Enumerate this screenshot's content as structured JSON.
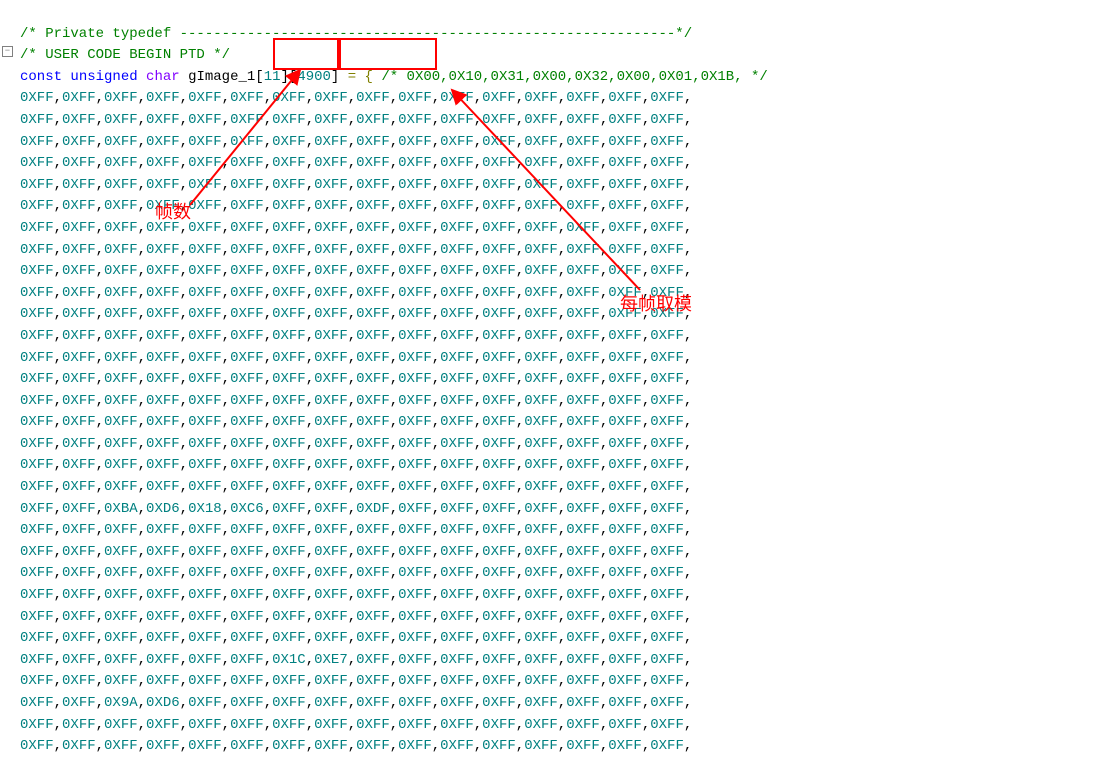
{
  "code": {
    "comment_line1": "/* Private typedef -----------------------------------------------------------*/",
    "comment_line2": "/* USER CODE BEGIN PTD */",
    "decl": {
      "const": "const",
      "unsigned": "unsigned",
      "char": "char",
      "name": "gImage_1",
      "dim1_open": "[",
      "dim1_val": "11",
      "dim1_close": "]",
      "dim2_open": "[",
      "dim2_val": "4900",
      "dim2_close": "]",
      "assign": " = {",
      "trailing_comment": " /* 0X00,0X10,0X31,0X00,0X32,0X00,0X01,0X1B, */"
    },
    "rows": [
      [
        "0XFF",
        "0XFF",
        "0XFF",
        "0XFF",
        "0XFF",
        "0XFF",
        "0XFF",
        "0XFF",
        "0XFF",
        "0XFF",
        "0XFF",
        "0XFF",
        "0XFF",
        "0XFF",
        "0XFF",
        "0XFF"
      ],
      [
        "0XFF",
        "0XFF",
        "0XFF",
        "0XFF",
        "0XFF",
        "0XFF",
        "0XFF",
        "0XFF",
        "0XFF",
        "0XFF",
        "0XFF",
        "0XFF",
        "0XFF",
        "0XFF",
        "0XFF",
        "0XFF"
      ],
      [
        "0XFF",
        "0XFF",
        "0XFF",
        "0XFF",
        "0XFF",
        "0XFF",
        "0XFF",
        "0XFF",
        "0XFF",
        "0XFF",
        "0XFF",
        "0XFF",
        "0XFF",
        "0XFF",
        "0XFF",
        "0XFF"
      ],
      [
        "0XFF",
        "0XFF",
        "0XFF",
        "0XFF",
        "0XFF",
        "0XFF",
        "0XFF",
        "0XFF",
        "0XFF",
        "0XFF",
        "0XFF",
        "0XFF",
        "0XFF",
        "0XFF",
        "0XFF",
        "0XFF"
      ],
      [
        "0XFF",
        "0XFF",
        "0XFF",
        "0XFF",
        "0XFF",
        "0XFF",
        "0XFF",
        "0XFF",
        "0XFF",
        "0XFF",
        "0XFF",
        "0XFF",
        "0XFF",
        "0XFF",
        "0XFF",
        "0XFF"
      ],
      [
        "0XFF",
        "0XFF",
        "0XFF",
        "0XFF",
        "0XFF",
        "0XFF",
        "0XFF",
        "0XFF",
        "0XFF",
        "0XFF",
        "0XFF",
        "0XFF",
        "0XFF",
        "0XFF",
        "0XFF",
        "0XFF"
      ],
      [
        "0XFF",
        "0XFF",
        "0XFF",
        "0XFF",
        "0XFF",
        "0XFF",
        "0XFF",
        "0XFF",
        "0XFF",
        "0XFF",
        "0XFF",
        "0XFF",
        "0XFF",
        "0XFF",
        "0XFF",
        "0XFF"
      ],
      [
        "0XFF",
        "0XFF",
        "0XFF",
        "0XFF",
        "0XFF",
        "0XFF",
        "0XFF",
        "0XFF",
        "0XFF",
        "0XFF",
        "0XFF",
        "0XFF",
        "0XFF",
        "0XFF",
        "0XFF",
        "0XFF"
      ],
      [
        "0XFF",
        "0XFF",
        "0XFF",
        "0XFF",
        "0XFF",
        "0XFF",
        "0XFF",
        "0XFF",
        "0XFF",
        "0XFF",
        "0XFF",
        "0XFF",
        "0XFF",
        "0XFF",
        "0XFF",
        "0XFF"
      ],
      [
        "0XFF",
        "0XFF",
        "0XFF",
        "0XFF",
        "0XFF",
        "0XFF",
        "0XFF",
        "0XFF",
        "0XFF",
        "0XFF",
        "0XFF",
        "0XFF",
        "0XFF",
        "0XFF",
        "0XFF",
        "0XFF"
      ],
      [
        "0XFF",
        "0XFF",
        "0XFF",
        "0XFF",
        "0XFF",
        "0XFF",
        "0XFF",
        "0XFF",
        "0XFF",
        "0XFF",
        "0XFF",
        "0XFF",
        "0XFF",
        "0XFF",
        "0XFF",
        "0XFF"
      ],
      [
        "0XFF",
        "0XFF",
        "0XFF",
        "0XFF",
        "0XFF",
        "0XFF",
        "0XFF",
        "0XFF",
        "0XFF",
        "0XFF",
        "0XFF",
        "0XFF",
        "0XFF",
        "0XFF",
        "0XFF",
        "0XFF"
      ],
      [
        "0XFF",
        "0XFF",
        "0XFF",
        "0XFF",
        "0XFF",
        "0XFF",
        "0XFF",
        "0XFF",
        "0XFF",
        "0XFF",
        "0XFF",
        "0XFF",
        "0XFF",
        "0XFF",
        "0XFF",
        "0XFF"
      ],
      [
        "0XFF",
        "0XFF",
        "0XFF",
        "0XFF",
        "0XFF",
        "0XFF",
        "0XFF",
        "0XFF",
        "0XFF",
        "0XFF",
        "0XFF",
        "0XFF",
        "0XFF",
        "0XFF",
        "0XFF",
        "0XFF"
      ],
      [
        "0XFF",
        "0XFF",
        "0XFF",
        "0XFF",
        "0XFF",
        "0XFF",
        "0XFF",
        "0XFF",
        "0XFF",
        "0XFF",
        "0XFF",
        "0XFF",
        "0XFF",
        "0XFF",
        "0XFF",
        "0XFF"
      ],
      [
        "0XFF",
        "0XFF",
        "0XFF",
        "0XFF",
        "0XFF",
        "0XFF",
        "0XFF",
        "0XFF",
        "0XFF",
        "0XFF",
        "0XFF",
        "0XFF",
        "0XFF",
        "0XFF",
        "0XFF",
        "0XFF"
      ],
      [
        "0XFF",
        "0XFF",
        "0XFF",
        "0XFF",
        "0XFF",
        "0XFF",
        "0XFF",
        "0XFF",
        "0XFF",
        "0XFF",
        "0XFF",
        "0XFF",
        "0XFF",
        "0XFF",
        "0XFF",
        "0XFF"
      ],
      [
        "0XFF",
        "0XFF",
        "0XFF",
        "0XFF",
        "0XFF",
        "0XFF",
        "0XFF",
        "0XFF",
        "0XFF",
        "0XFF",
        "0XFF",
        "0XFF",
        "0XFF",
        "0XFF",
        "0XFF",
        "0XFF"
      ],
      [
        "0XFF",
        "0XFF",
        "0XFF",
        "0XFF",
        "0XFF",
        "0XFF",
        "0XFF",
        "0XFF",
        "0XFF",
        "0XFF",
        "0XFF",
        "0XFF",
        "0XFF",
        "0XFF",
        "0XFF",
        "0XFF"
      ],
      [
        "0XFF",
        "0XFF",
        "0XBA",
        "0XD6",
        "0X18",
        "0XC6",
        "0XFF",
        "0XFF",
        "0XDF",
        "0XFF",
        "0XFF",
        "0XFF",
        "0XFF",
        "0XFF",
        "0XFF",
        "0XFF"
      ],
      [
        "0XFF",
        "0XFF",
        "0XFF",
        "0XFF",
        "0XFF",
        "0XFF",
        "0XFF",
        "0XFF",
        "0XFF",
        "0XFF",
        "0XFF",
        "0XFF",
        "0XFF",
        "0XFF",
        "0XFF",
        "0XFF"
      ],
      [
        "0XFF",
        "0XFF",
        "0XFF",
        "0XFF",
        "0XFF",
        "0XFF",
        "0XFF",
        "0XFF",
        "0XFF",
        "0XFF",
        "0XFF",
        "0XFF",
        "0XFF",
        "0XFF",
        "0XFF",
        "0XFF"
      ],
      [
        "0XFF",
        "0XFF",
        "0XFF",
        "0XFF",
        "0XFF",
        "0XFF",
        "0XFF",
        "0XFF",
        "0XFF",
        "0XFF",
        "0XFF",
        "0XFF",
        "0XFF",
        "0XFF",
        "0XFF",
        "0XFF"
      ],
      [
        "0XFF",
        "0XFF",
        "0XFF",
        "0XFF",
        "0XFF",
        "0XFF",
        "0XFF",
        "0XFF",
        "0XFF",
        "0XFF",
        "0XFF",
        "0XFF",
        "0XFF",
        "0XFF",
        "0XFF",
        "0XFF"
      ],
      [
        "0XFF",
        "0XFF",
        "0XFF",
        "0XFF",
        "0XFF",
        "0XFF",
        "0XFF",
        "0XFF",
        "0XFF",
        "0XFF",
        "0XFF",
        "0XFF",
        "0XFF",
        "0XFF",
        "0XFF",
        "0XFF"
      ],
      [
        "0XFF",
        "0XFF",
        "0XFF",
        "0XFF",
        "0XFF",
        "0XFF",
        "0XFF",
        "0XFF",
        "0XFF",
        "0XFF",
        "0XFF",
        "0XFF",
        "0XFF",
        "0XFF",
        "0XFF",
        "0XFF"
      ],
      [
        "0XFF",
        "0XFF",
        "0XFF",
        "0XFF",
        "0XFF",
        "0XFF",
        "0X1C",
        "0XE7",
        "0XFF",
        "0XFF",
        "0XFF",
        "0XFF",
        "0XFF",
        "0XFF",
        "0XFF",
        "0XFF"
      ],
      [
        "0XFF",
        "0XFF",
        "0XFF",
        "0XFF",
        "0XFF",
        "0XFF",
        "0XFF",
        "0XFF",
        "0XFF",
        "0XFF",
        "0XFF",
        "0XFF",
        "0XFF",
        "0XFF",
        "0XFF",
        "0XFF"
      ],
      [
        "0XFF",
        "0XFF",
        "0X9A",
        "0XD6",
        "0XFF",
        "0XFF",
        "0XFF",
        "0XFF",
        "0XFF",
        "0XFF",
        "0XFF",
        "0XFF",
        "0XFF",
        "0XFF",
        "0XFF",
        "0XFF"
      ],
      [
        "0XFF",
        "0XFF",
        "0XFF",
        "0XFF",
        "0XFF",
        "0XFF",
        "0XFF",
        "0XFF",
        "0XFF",
        "0XFF",
        "0XFF",
        "0XFF",
        "0XFF",
        "0XFF",
        "0XFF",
        "0XFF"
      ],
      [
        "0XFF",
        "0XFF",
        "0XFF",
        "0XFF",
        "0XFF",
        "0XFF",
        "0XFF",
        "0XFF",
        "0XFF",
        "0XFF",
        "0XFF",
        "0XFF",
        "0XFF",
        "0XFF",
        "0XFF",
        "0XFF"
      ]
    ]
  },
  "annotations": {
    "label_frame_count": "帧数",
    "label_per_frame_mod": "每帧取模"
  }
}
